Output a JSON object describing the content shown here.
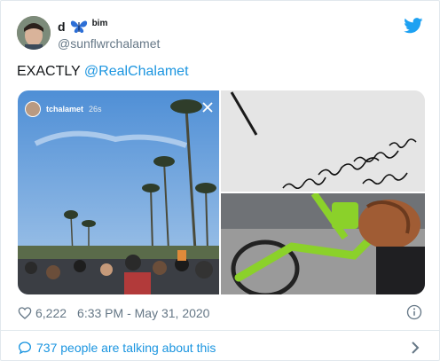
{
  "author": {
    "display_name": "d",
    "name_suffix": "bim",
    "handle": "@sunflwrchalamet",
    "avatar_icon": "user-avatar",
    "emoji_icon": "butterfly-icon"
  },
  "tweet": {
    "text_prefix": "EXACTLY ",
    "mention": "@RealChalamet"
  },
  "media": {
    "story_username": "tchalamet",
    "story_time": "26s"
  },
  "meta": {
    "likes": "6,222",
    "timestamp": "6:33 PM - May 31, 2020"
  },
  "footer": {
    "talking_text": "737 people are talking about this"
  },
  "colors": {
    "accent": "#1b95e0",
    "secondary_text": "#657786",
    "border": "#e1e8ed"
  }
}
